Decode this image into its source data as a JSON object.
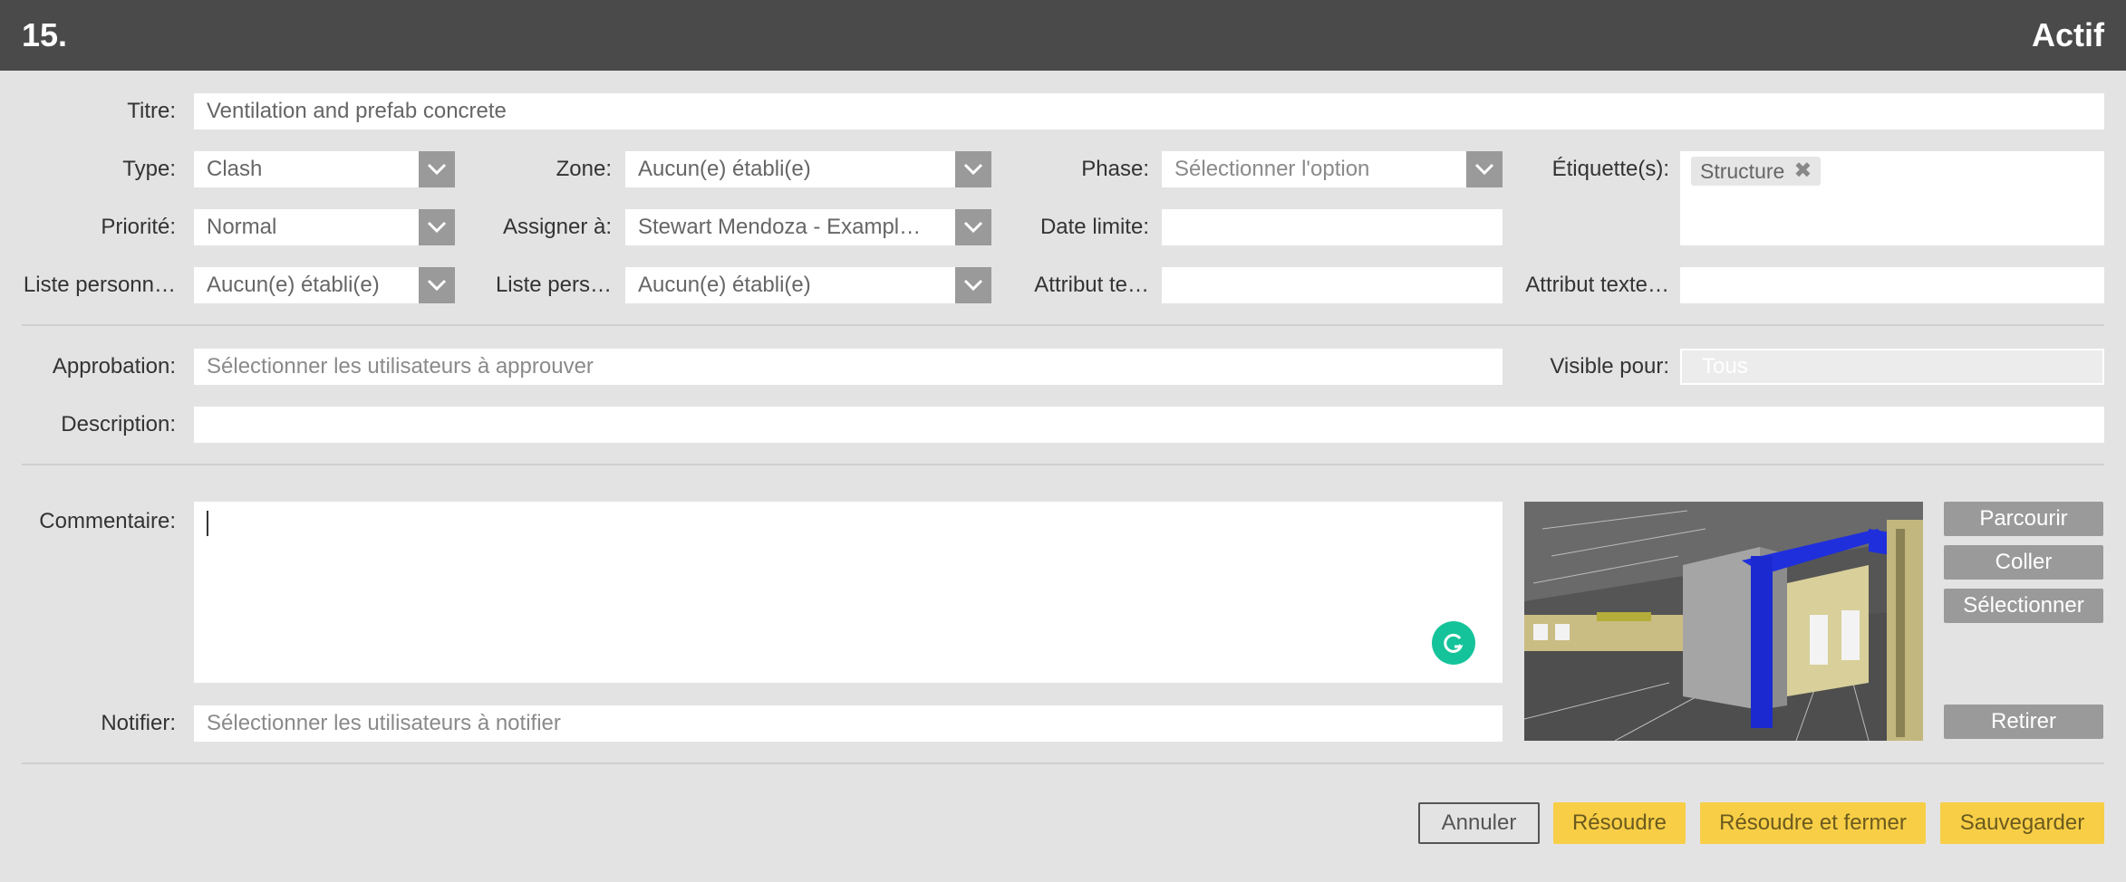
{
  "header": {
    "number": "15.",
    "status": "Actif"
  },
  "fields": {
    "title": {
      "label": "Titre:",
      "value": "Ventilation and prefab concrete"
    },
    "type": {
      "label": "Type:",
      "value": "Clash"
    },
    "zone": {
      "label": "Zone:",
      "value": "Aucun(e) établi(e)"
    },
    "phase": {
      "label": "Phase:",
      "placeholder": "Sélectionner l'option"
    },
    "tags": {
      "label": "Étiquette(s):",
      "items": [
        "Structure"
      ]
    },
    "priority": {
      "label": "Priorité:",
      "value": "Normal"
    },
    "assign": {
      "label": "Assigner à:",
      "value": "Stewart Mendoza - Exampl…"
    },
    "due_date": {
      "label": "Date limite:",
      "value": ""
    },
    "custom_list_1": {
      "label": "Liste personn…",
      "value": "Aucun(e) établi(e)"
    },
    "custom_list_2": {
      "label": "Liste pers…",
      "value": "Aucun(e) établi(e)"
    },
    "text_attr_1": {
      "label": "Attribut te…",
      "value": ""
    },
    "text_attr_2": {
      "label": "Attribut texte…",
      "value": ""
    },
    "approval": {
      "label": "Approbation:",
      "placeholder": "Sélectionner les utilisateurs à approuver"
    },
    "visible_for": {
      "label": "Visible pour:",
      "value": "Tous"
    },
    "description": {
      "label": "Description:",
      "value": ""
    },
    "comment": {
      "label": "Commentaire:",
      "value": ""
    },
    "notify": {
      "label": "Notifier:",
      "placeholder": "Sélectionner les utilisateurs à notifier"
    }
  },
  "attachment_buttons": {
    "browse": "Parcourir",
    "paste": "Coller",
    "select": "Sélectionner",
    "remove": "Retirer"
  },
  "actions": {
    "cancel": "Annuler",
    "resolve": "Résoudre",
    "resolve_close": "Résoudre et fermer",
    "save": "Sauvegarder"
  },
  "colors": {
    "header_bg": "#4a4a4a",
    "page_bg": "#e4e3e3",
    "accent_yellow": "#f7ce46",
    "grammarly_green": "#15c39a"
  }
}
